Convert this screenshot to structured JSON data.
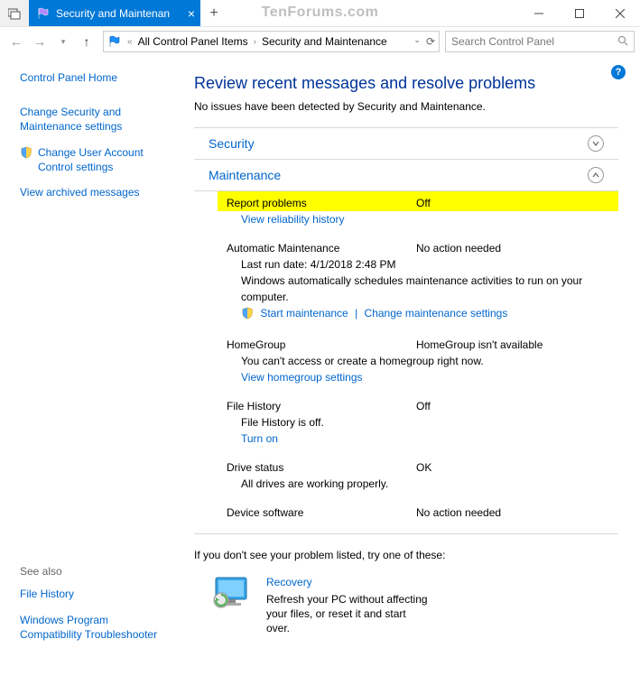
{
  "watermark": "TenForums.com",
  "tab": {
    "title": "Security and Maintenan"
  },
  "breadcrumb": {
    "item1": "All Control Panel Items",
    "item2": "Security and Maintenance"
  },
  "search": {
    "placeholder": "Search Control Panel"
  },
  "sidebar": {
    "home": "Control Panel Home",
    "change_security": "Change Security and Maintenance settings",
    "change_uac": "Change User Account Control settings",
    "archived": "View archived messages",
    "see_also": "See also",
    "file_history": "File History",
    "compat": "Windows Program Compatibility Troubleshooter"
  },
  "main": {
    "title": "Review recent messages and resolve problems",
    "subtitle": "No issues have been detected by Security and Maintenance.",
    "security_header": "Security",
    "maintenance_header": "Maintenance",
    "report_problems": {
      "label": "Report problems",
      "status": "Off",
      "link": "View reliability history"
    },
    "auto_maint": {
      "label": "Automatic Maintenance",
      "status": "No action needed",
      "lastrun": "Last run date: 4/1/2018 2:48 PM",
      "desc": "Windows automatically schedules maintenance activities to run on your computer.",
      "start": "Start maintenance",
      "change": "Change maintenance settings"
    },
    "homegroup": {
      "label": "HomeGroup",
      "status": "HomeGroup isn't available",
      "desc": "You can't access or create a homegroup right now.",
      "link": "View homegroup settings"
    },
    "file_history": {
      "label": "File History",
      "status": "Off",
      "desc": "File History is off.",
      "link": "Turn on"
    },
    "drive": {
      "label": "Drive status",
      "status": "OK",
      "desc": "All drives are working properly."
    },
    "device_sw": {
      "label": "Device software",
      "status": "No action needed"
    },
    "footer": "If you don't see your problem listed, try one of these:",
    "recovery": {
      "title": "Recovery",
      "desc": "Refresh your PC without affecting your files, or reset it and start over."
    }
  }
}
